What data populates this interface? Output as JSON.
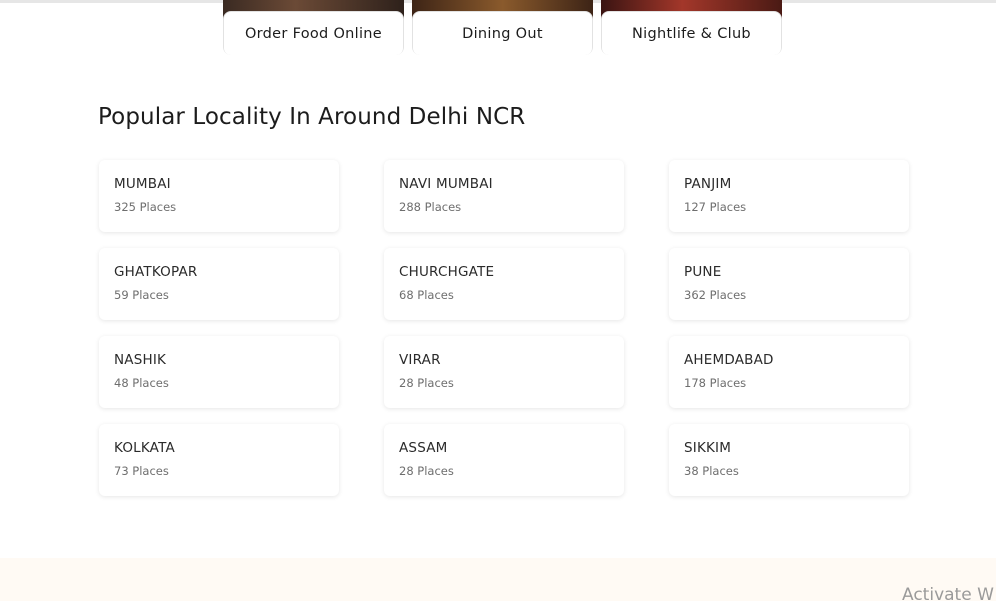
{
  "categories": [
    {
      "label": "Order Food Online"
    },
    {
      "label": "Dining Out"
    },
    {
      "label": "Nightlife & Club"
    }
  ],
  "section": {
    "title": "Popular Locality In Around Delhi NCR"
  },
  "localities": [
    {
      "name": "MUMBAI",
      "places": "325 Places"
    },
    {
      "name": "NAVI MUMBAI",
      "places": "288 Places"
    },
    {
      "name": "PANJIM",
      "places": "127 Places"
    },
    {
      "name": "GHATKOPAR",
      "places": "59 Places"
    },
    {
      "name": "CHURCHGATE",
      "places": "68 Places"
    },
    {
      "name": "PUNE",
      "places": "362 Places"
    },
    {
      "name": "NASHIK",
      "places": "48 Places"
    },
    {
      "name": "VIRAR",
      "places": "28 Places"
    },
    {
      "name": "AHEMDABAD",
      "places": "178 Places"
    },
    {
      "name": "KOLKATA",
      "places": "73 Places"
    },
    {
      "name": "ASSAM",
      "places": "28 Places"
    },
    {
      "name": "SIKKIM",
      "places": "38 Places"
    }
  ],
  "watermark": {
    "text": "Activate W"
  },
  "colors": {
    "text_primary": "#1c1c1c",
    "text_secondary": "#6e6e6e",
    "footer_band": "#fffaf4"
  }
}
